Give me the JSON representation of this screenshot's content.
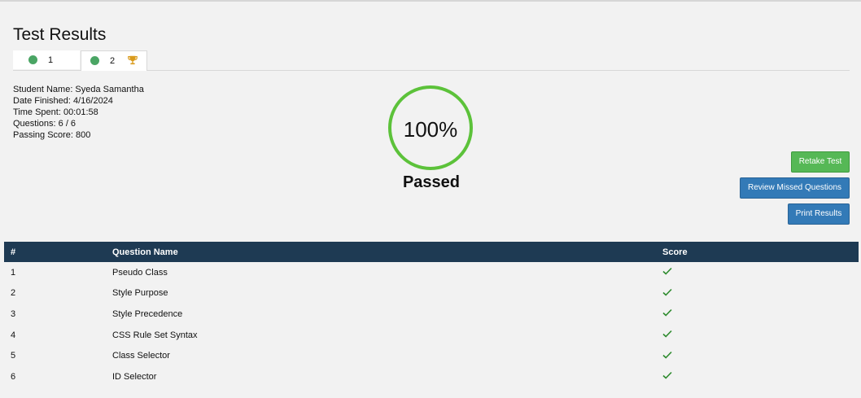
{
  "page": {
    "title": "Test Results"
  },
  "tabs": [
    {
      "label": "1",
      "status_color": "#4aa564",
      "active": false
    },
    {
      "label": "2",
      "status_color": "#4aa564",
      "active": true,
      "badge_icon": "trophy-icon"
    }
  ],
  "student": {
    "name": "Student Name: Syeda Samantha",
    "date_finished": "Date Finished: 4/16/2024",
    "time_spent": "Time Spent: 00:01:58",
    "questions": "Questions: 6 / 6",
    "passing_score": "Passing Score: 800"
  },
  "score": {
    "percent": "100%",
    "status": "Passed",
    "ring_color": "#5cc23a"
  },
  "actions": {
    "retake": "Retake Test",
    "review": "Review Missed Questions",
    "print": "Print Results"
  },
  "table": {
    "headers": [
      "#",
      "Question Name",
      "Score"
    ],
    "rows": [
      {
        "num": "1",
        "name": "Pseudo Class",
        "score_icon": "check-icon"
      },
      {
        "num": "2",
        "name": "Style Purpose",
        "score_icon": "check-icon"
      },
      {
        "num": "3",
        "name": "Style Precedence",
        "score_icon": "check-icon"
      },
      {
        "num": "4",
        "name": "CSS Rule Set Syntax",
        "score_icon": "check-icon"
      },
      {
        "num": "5",
        "name": "Class Selector",
        "score_icon": "check-icon"
      },
      {
        "num": "6",
        "name": "ID Selector",
        "score_icon": "check-icon"
      }
    ]
  },
  "colors": {
    "header_bg": "#1e3a53",
    "check": "#2e8b2e",
    "success_btn": "#56b856",
    "primary_btn": "#337ab7"
  }
}
